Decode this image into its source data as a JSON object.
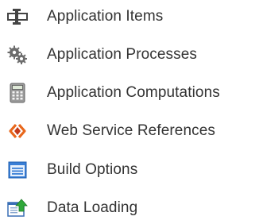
{
  "menu": {
    "items": [
      {
        "label": "Application Items",
        "icon": "application-items-icon"
      },
      {
        "label": "Application Processes",
        "icon": "gears-icon"
      },
      {
        "label": "Application Computations",
        "icon": "calculator-icon"
      },
      {
        "label": "Web Service References",
        "icon": "web-service-icon"
      },
      {
        "label": "Build Options",
        "icon": "build-options-icon"
      },
      {
        "label": "Data Loading",
        "icon": "data-loading-icon"
      }
    ]
  },
  "colors": {
    "text": "#333333",
    "web_service_orange": "#e8671c",
    "build_blue": "#3a7fd6",
    "data_green": "#2fa83a"
  }
}
